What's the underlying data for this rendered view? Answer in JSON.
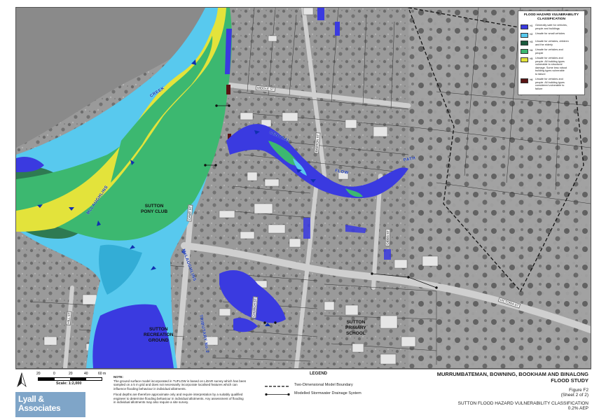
{
  "map": {
    "labels": {
      "creek": "CREEK",
      "mclaughlins_upper": "McLAUGHLINS",
      "mclaughlins_lower": "McLAUGHLINS",
      "central": "CENTRAL",
      "flow": "FLOW",
      "path": "PATH",
      "pony_club": "SUTTON\nPONY CLUB",
      "recreation_ground": "SUTTON\nRECREATION\nGROUND",
      "primary_school": "SUTTON\nPRIMARY\nSCHOOL",
      "tributary": "TRIBUTARY No.2"
    },
    "streets": [
      "MIDDLE ST",
      "CAMP ST",
      "VICTORIA ST",
      "GIBBS ST",
      "HILL ST",
      "BARTON ST",
      "CHURCH ST"
    ]
  },
  "legend_hazard": {
    "title": "FLOOD HAZARD VULNERABILITY\nCLASSIFICATION",
    "classes": [
      {
        "code": "H1",
        "color": "#3a3ae0",
        "text": "Generally safe for vehicles,\npeople and buildings"
      },
      {
        "code": "H2",
        "color": "#58c9ee",
        "text": "Unsafe for small vehicles"
      },
      {
        "code": "H3",
        "color": "#1b5a3d",
        "text": "Unsafe for vehicles, children\nand the elderly"
      },
      {
        "code": "H4",
        "color": "#3cb870",
        "text": "Unsafe for vehicles and\npeople"
      },
      {
        "code": "H5",
        "color": "#e3e33b",
        "text": "Unsafe for vehicles and\npeople. All building types\nvulnerable to structural\ndamage. Some less robust\nbuilding types vulnerable\nto failure"
      },
      {
        "code": "H6",
        "color": "#5a1414",
        "text": "Unsafe for vehicles and\npeople. All building types\nconsidered vulnerable to\nfailure"
      }
    ]
  },
  "footer": {
    "scale_ticks": [
      "20",
      "0",
      "20",
      "40",
      "60 m"
    ],
    "scale_text": "Scale: 1:2,000",
    "note_title": "NOTE:",
    "note_p1": "The ground surface model incorporated in TUFLOW is based on LiDAR survey which has been sampled on a 5 m grid and does not necessarily incorporate localised features which can influence flooding behaviour in individual allotments.",
    "note_p2": "Flood depths are therefore approximate only and require interpretation by a suitably qualified engineer to determine flooding behaviour in individual allotments. Any assessment of flooding in individual allotments may also require a site survey.",
    "legend_title": "LEGEND",
    "legend_items": [
      "Two-Dimensional Model Boundary",
      "Modelled Stormwater Drainage System"
    ],
    "logo_line1": "Lyall &",
    "logo_line2": "Associates",
    "project_line1": "MURRUMBATEMAN, BOWNING, BOOKHAM AND BINALONG",
    "project_line2": "FLOOD STUDY",
    "figure": "Figure F2",
    "sheet": "(Sheet 2 of 2)",
    "fig_title": "SUTTON FLOOD HAZARD VULNERABILITY CLASSIFICATION",
    "aep": "0.2% AEP"
  }
}
